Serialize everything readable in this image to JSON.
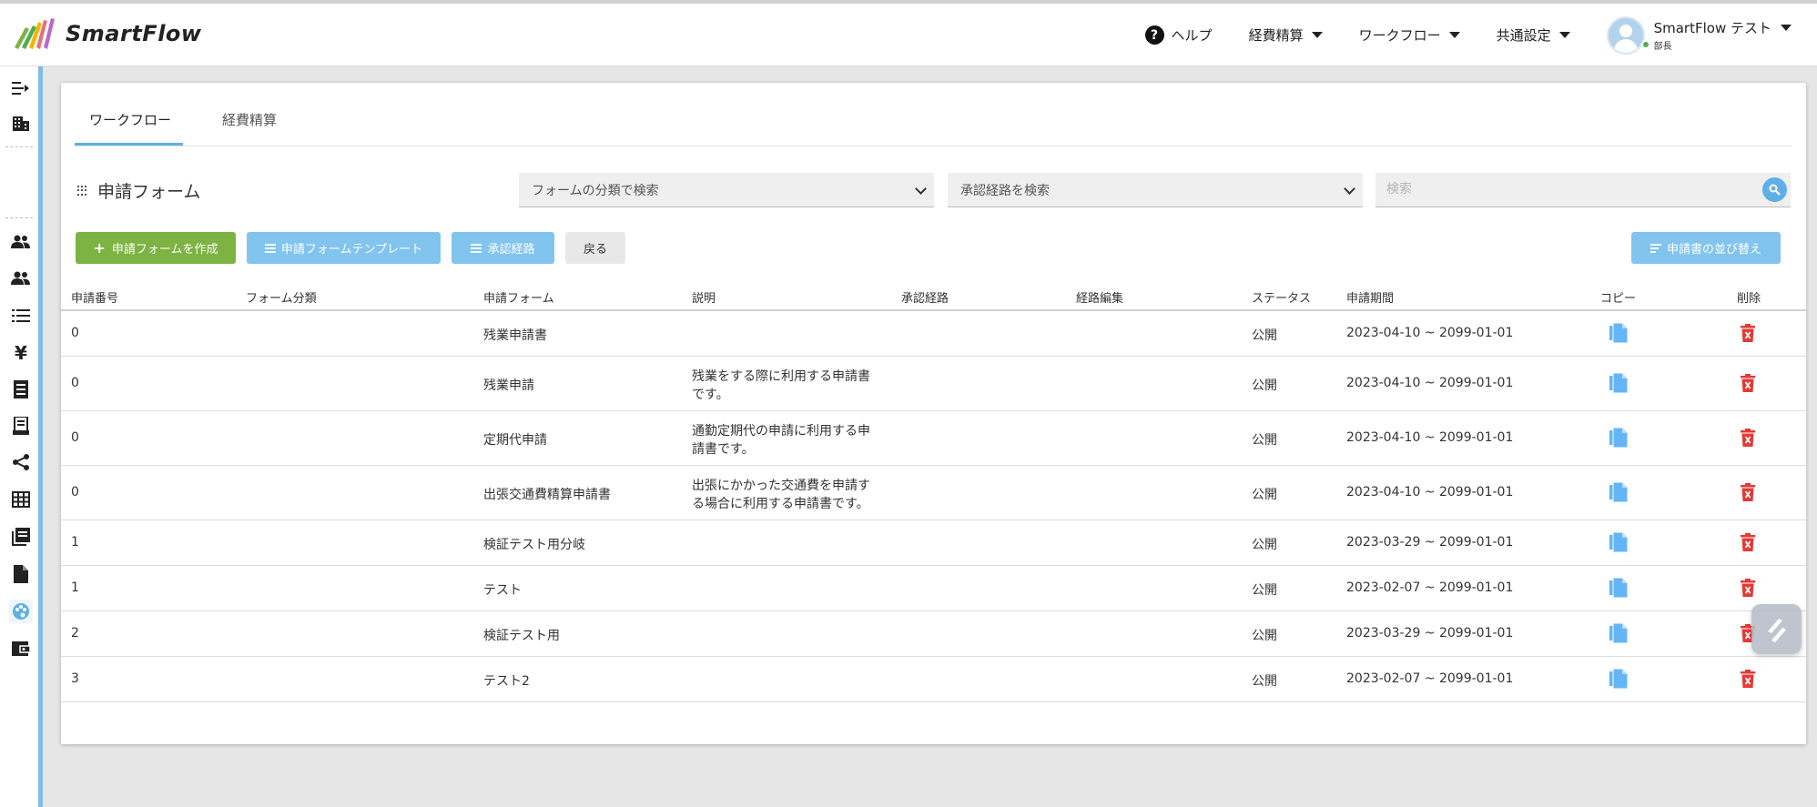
{
  "app": {
    "logo_text": "SmartFlow"
  },
  "header": {
    "help_label": "ヘルプ",
    "menu_expense": "経費精算",
    "menu_workflow": "ワークフロー",
    "menu_common": "共通設定",
    "user_name": "SmartFlow テスト",
    "user_role": "部長"
  },
  "tabs": {
    "workflow": "ワークフロー",
    "expense": "経費精算"
  },
  "section": {
    "title": "申請フォーム"
  },
  "filters": {
    "category_placeholder": "フォームの分類で検索",
    "route_placeholder": "承認経路を検索",
    "search_placeholder": "検索"
  },
  "buttons": {
    "create_form": "申請フォームを作成",
    "form_template": "申請フォームテンプレート",
    "approval_route": "承認経路",
    "back": "戻る",
    "sort_forms": "申請書の並び替え"
  },
  "table": {
    "headers": {
      "number": "申請番号",
      "category": "フォーム分類",
      "form": "申請フォーム",
      "description": "説明",
      "route": "承認経路",
      "route_edit": "経路編集",
      "status": "ステータス",
      "period": "申請期間",
      "copy": "コピー",
      "delete": "削除"
    },
    "rows": [
      {
        "number": "0",
        "category": "",
        "form": "残業申請書",
        "desc1": "",
        "desc2": "",
        "status": "公開",
        "period": "2023-04-10 ~ 2099-01-01"
      },
      {
        "number": "0",
        "category": "",
        "form": "残業申請",
        "desc1": "残業をする際に利用する申請書",
        "desc2": "です。",
        "status": "公開",
        "period": "2023-04-10 ~ 2099-01-01"
      },
      {
        "number": "0",
        "category": "",
        "form": "定期代申請",
        "desc1": "通勤定期代の申請に利用する申",
        "desc2": "請書です。",
        "status": "公開",
        "period": "2023-04-10 ~ 2099-01-01"
      },
      {
        "number": "0",
        "category": "",
        "form": "出張交通費精算申請書",
        "desc1": "出張にかかった交通費を申請す",
        "desc2": "る場合に利用する申請書です。",
        "status": "公開",
        "period": "2023-04-10 ~ 2099-01-01"
      },
      {
        "number": "1",
        "category": "",
        "form": "検証テスト用分岐",
        "desc1": "",
        "desc2": "",
        "status": "公開",
        "period": "2023-03-29 ~ 2099-01-01"
      },
      {
        "number": "1",
        "category": "",
        "form": "テスト",
        "desc1": "",
        "desc2": "",
        "status": "公開",
        "period": "2023-02-07 ~ 2099-01-01"
      },
      {
        "number": "2",
        "category": "",
        "form": "検証テスト用",
        "desc1": "",
        "desc2": "",
        "status": "公開",
        "period": "2023-03-29 ~ 2099-01-01"
      },
      {
        "number": "3",
        "category": "",
        "form": "テスト2",
        "desc1": "",
        "desc2": "",
        "status": "公開",
        "period": "2023-02-07 ~ 2099-01-01"
      }
    ]
  },
  "colors": {
    "accent_blue": "#5eb0e5",
    "button_blue": "#81c4ee",
    "button_green": "#7cb342",
    "delete_red": "#e53935",
    "copy_blue": "#64b5f6"
  }
}
